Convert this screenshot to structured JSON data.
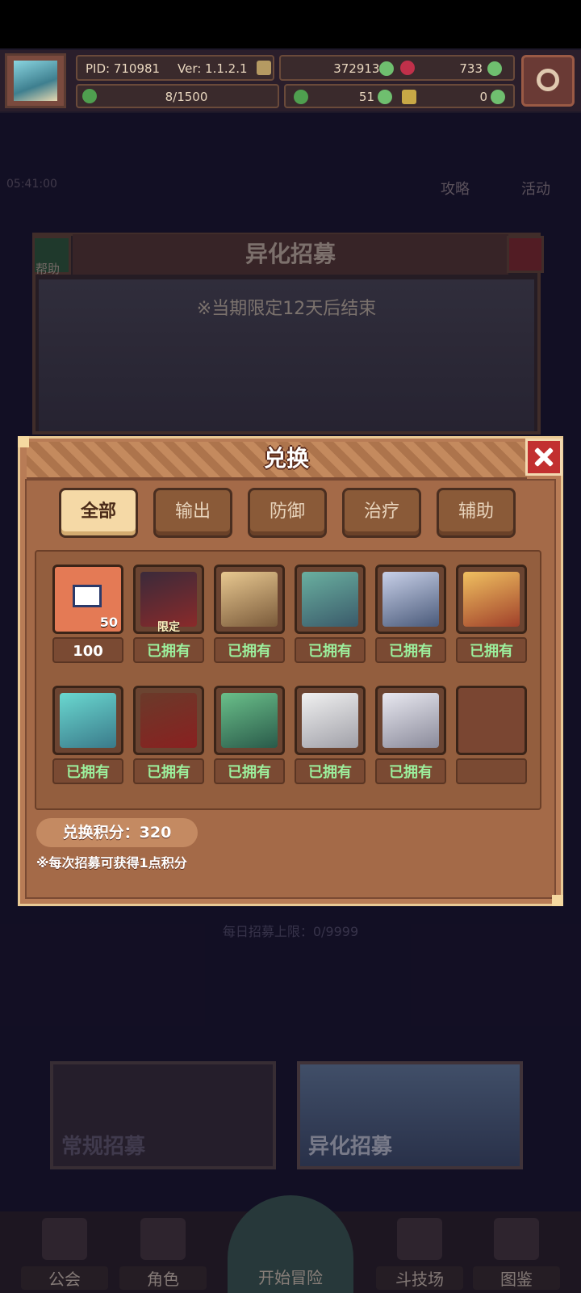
{
  "status_bar": {
    "pid": "PID: 710981",
    "version": "Ver: 1.1.2.1",
    "gold": "3729139",
    "gems": "733",
    "progress": "8/1500",
    "clover": "51",
    "item": "0"
  },
  "background": {
    "timer": "05:41:00",
    "guide_label": "攻略",
    "event_label": "活动",
    "recruit_title": "异化招募",
    "help_label": "帮助",
    "limited_note": "※当期限定12天后结束",
    "daily_limit": "每日招募上限：0/9999",
    "cards": [
      "常规招募",
      "异化招募"
    ],
    "nav": [
      "公会",
      "角色",
      "开始冒险",
      "斗技场",
      "图鉴"
    ]
  },
  "modal": {
    "title": "兑换",
    "tabs": [
      "全部",
      "输出",
      "防御",
      "治疗",
      "辅助"
    ],
    "items": [
      {
        "label": "100",
        "badge": "50"
      },
      {
        "label": "已拥有",
        "tag": "限定"
      },
      {
        "label": "已拥有"
      },
      {
        "label": "已拥有"
      },
      {
        "label": "已拥有"
      },
      {
        "label": "已拥有"
      },
      {
        "label": "已拥有"
      },
      {
        "label": "已拥有"
      },
      {
        "label": "已拥有"
      },
      {
        "label": "已拥有"
      },
      {
        "label": "已拥有"
      }
    ],
    "points": "兑换积分：320",
    "note": "※每次招募可获得1点积分"
  },
  "colors": {
    "owned_text": "#9cef9c",
    "modal_bg": "#b87c56",
    "close_red": "#c23030",
    "active_tab": "#f5d9a6"
  }
}
